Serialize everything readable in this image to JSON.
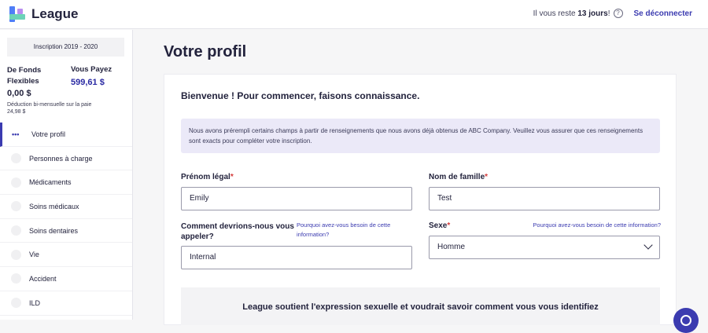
{
  "header": {
    "brand": "League",
    "remaining_prefix": "Il vous reste ",
    "remaining_days": "13 jours",
    "remaining_suffix": "!",
    "help": "?",
    "logout": "Se déconnecter"
  },
  "sidebar": {
    "enrollment": "Inscription 2019 - 2020",
    "funds_label": "De Fonds Flexibles",
    "funds_amount": "0,00 $",
    "pay_label": "Vous Payez",
    "pay_amount": "599,61 $",
    "deduction_text": "Déduction bi-mensuelle sur la paie",
    "deduction_amount": "24,98 $",
    "active_marker": "•••",
    "items": [
      {
        "label": "Votre profil"
      },
      {
        "label": "Personnes à charge"
      },
      {
        "label": "Médicaments"
      },
      {
        "label": "Soins médicaux"
      },
      {
        "label": "Soins dentaires"
      },
      {
        "label": "Vie"
      },
      {
        "label": "Accident"
      },
      {
        "label": "ILD"
      }
    ]
  },
  "main": {
    "title": "Votre profil",
    "welcome": "Bienvenue ! Pour commencer, faisons connaissance.",
    "notice": "Nous avons prérempli certains champs à partir de renseignements que nous avons déjà obtenus de ABC Company. Veuillez vous assurer que ces renseignements sont exacts pour compléter votre inscription.",
    "required_mark": "*",
    "fields": {
      "first_name": {
        "label": "Prénom légal",
        "value": "Emily"
      },
      "last_name": {
        "label": "Nom de famille",
        "value": "Test"
      },
      "preferred_name": {
        "label": "Comment devrions-nous vous appeler?",
        "value": "Internal",
        "why": "Pourquoi avez-vous besoin de cette information?"
      },
      "sex": {
        "label": "Sexe",
        "value": "Homme",
        "why": "Pourquoi avez-vous besoin de cette information?"
      }
    },
    "banner": "League soutient l'expression sexuelle et voudrait savoir comment vous vous identifiez"
  },
  "colors": {
    "accent": "#3b3bb0",
    "required": "#d43b3b",
    "notice_bg": "#ebe9f8"
  }
}
